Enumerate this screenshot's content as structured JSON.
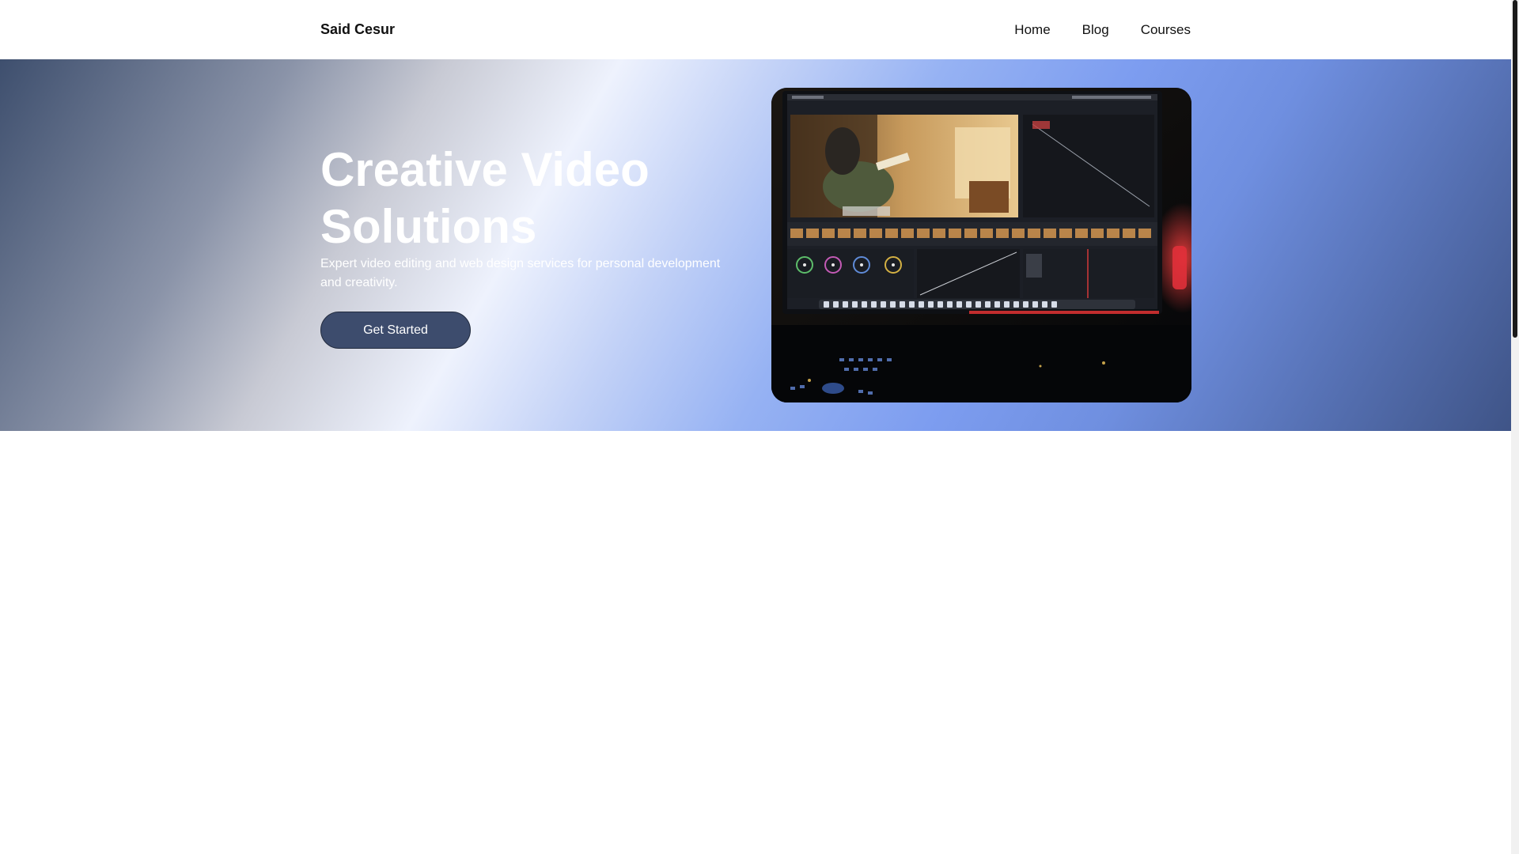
{
  "header": {
    "brand": "Said Cesur",
    "nav": [
      {
        "label": "Home"
      },
      {
        "label": "Blog"
      },
      {
        "label": "Courses"
      }
    ]
  },
  "hero": {
    "title": "Creative Video Solutions",
    "subtitle": "Expert video editing and web design services for personal development and creativity.",
    "cta_label": "Get Started",
    "image_icon": "video-editing-monitor-photo"
  },
  "colors": {
    "accent": "#3d4c6d",
    "hero_gradient_mid": "#eef2fd",
    "hero_gradient_blue": "#7d9df0"
  }
}
